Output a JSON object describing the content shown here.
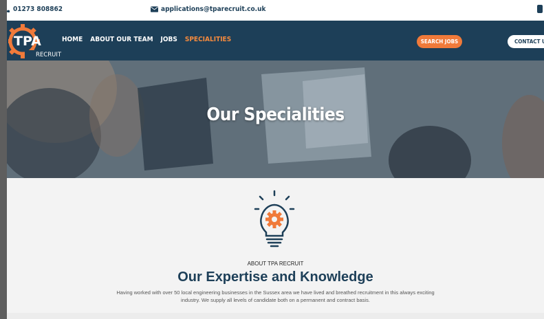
{
  "topbar": {
    "phone": "01273 808862",
    "email": "applications@tparecruit.co.uk"
  },
  "logo": {
    "main": "TPA",
    "sub": "RECRUIT"
  },
  "nav": {
    "items": [
      {
        "label": "HOME"
      },
      {
        "label": "ABOUT OUR TEAM"
      },
      {
        "label": "JOBS"
      },
      {
        "label": "SPECIALITIES"
      }
    ],
    "search_button": "SEARCH JOBS",
    "contact_button": "CONTACT US"
  },
  "hero": {
    "title": "Our Specialities"
  },
  "about": {
    "eyebrow": "ABOUT TPA RECRUIT",
    "heading": "Our Expertise and Knowledge",
    "description": "Having worked with over 50 local engineering businesses in the Sussex area we have lived and breathed recruitment in this always exciting industry. We supply all levels of candidate both on a permanent and contract basis."
  },
  "colors": {
    "navy": "#1d3f58",
    "orange": "#f07a3a"
  }
}
